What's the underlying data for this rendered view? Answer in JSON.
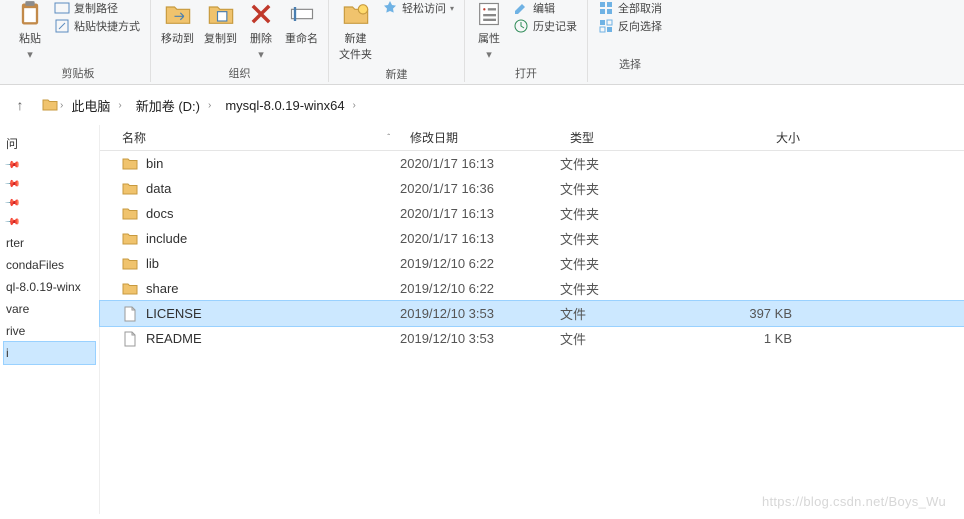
{
  "ribbon": {
    "clipboard": {
      "paste": "粘贴",
      "copy_path": "复制路径",
      "paste_shortcut": "粘贴快捷方式",
      "label": "剪贴板"
    },
    "organize": {
      "move_to": "移动到",
      "copy_to": "复制到",
      "delete": "删除",
      "rename": "重命名",
      "label": "组织"
    },
    "new_group": {
      "new_folder": "新建\n文件夹",
      "label": "新建"
    },
    "open_group": {
      "easy_access": "轻松访问",
      "properties": "属性",
      "edit": "编辑",
      "history": "历史记录",
      "label": "打开"
    },
    "select_group": {
      "select_all": "全部取消",
      "invert": "反向选择",
      "label": "选择"
    }
  },
  "breadcrumb": {
    "items": [
      "此电脑",
      "新加卷 (D:)",
      "mysql-8.0.19-winx64"
    ]
  },
  "sidebar": {
    "items": [
      {
        "label": "问",
        "pinned": false
      },
      {
        "label": "",
        "pinned": true
      },
      {
        "label": "",
        "pinned": true
      },
      {
        "label": "",
        "pinned": true
      },
      {
        "label": "",
        "pinned": true
      },
      {
        "label": "rter",
        "pinned": false
      },
      {
        "label": "condaFiles",
        "pinned": false
      },
      {
        "label": "ql-8.0.19-winx",
        "pinned": false
      },
      {
        "label": "vare",
        "pinned": false
      },
      {
        "label": "rive",
        "pinned": false
      },
      {
        "label": "i",
        "pinned": false,
        "selected": true
      }
    ]
  },
  "columns": {
    "name": "名称",
    "date": "修改日期",
    "type": "类型",
    "size": "大小"
  },
  "rows": [
    {
      "kind": "dir",
      "name": "bin",
      "date": "2020/1/17 16:13",
      "type": "文件夹",
      "size": ""
    },
    {
      "kind": "dir",
      "name": "data",
      "date": "2020/1/17 16:36",
      "type": "文件夹",
      "size": ""
    },
    {
      "kind": "dir",
      "name": "docs",
      "date": "2020/1/17 16:13",
      "type": "文件夹",
      "size": ""
    },
    {
      "kind": "dir",
      "name": "include",
      "date": "2020/1/17 16:13",
      "type": "文件夹",
      "size": ""
    },
    {
      "kind": "dir",
      "name": "lib",
      "date": "2019/12/10 6:22",
      "type": "文件夹",
      "size": ""
    },
    {
      "kind": "dir",
      "name": "share",
      "date": "2019/12/10 6:22",
      "type": "文件夹",
      "size": ""
    },
    {
      "kind": "file",
      "name": "LICENSE",
      "date": "2019/12/10 3:53",
      "type": "文件",
      "size": "397 KB",
      "selected": true
    },
    {
      "kind": "file",
      "name": "README",
      "date": "2019/12/10 3:53",
      "type": "文件",
      "size": "1 KB"
    }
  ],
  "watermark": "https://blog.csdn.net/Boys_Wu"
}
